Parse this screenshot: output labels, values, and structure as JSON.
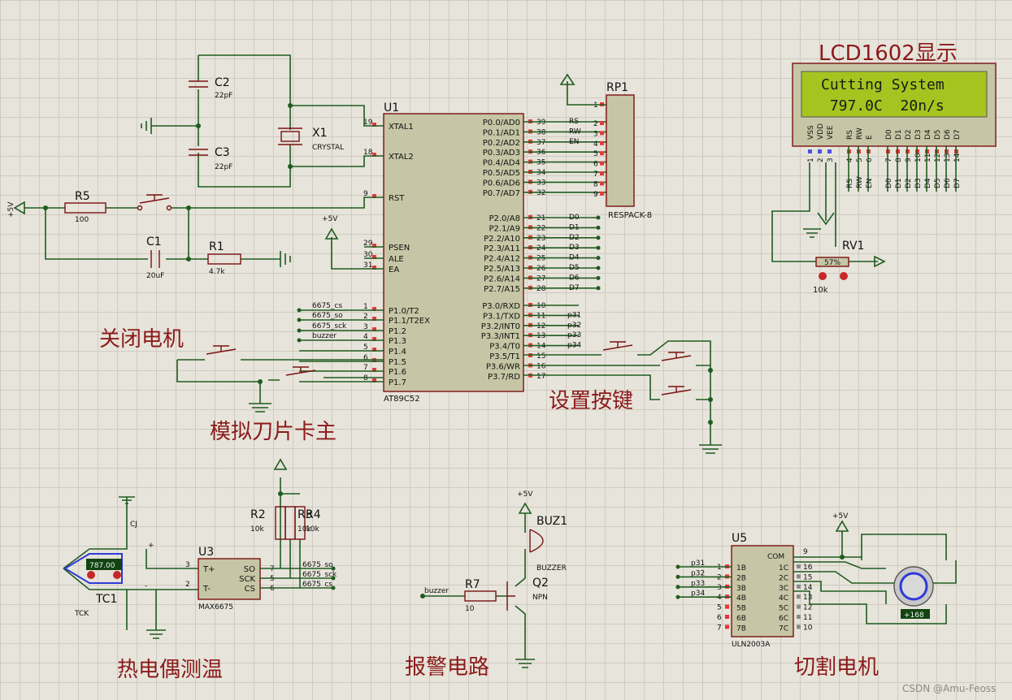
{
  "labels": {
    "lcd_title": "LCD1602显示",
    "close_motor": "关闭电机",
    "simulate_blade": "模拟刀片卡主",
    "set_keys": "设置按键",
    "thermocouple": "热电偶测温",
    "alarm": "报警电路",
    "cut_motor": "切割电机",
    "watermark": "CSDN @Amu-Feoss"
  },
  "lcd": {
    "line1": "Cutting System",
    "line2": " 797.0C  20n/s",
    "pins": [
      "VSS",
      "VDD",
      "VEE",
      "RS",
      "RW",
      "E",
      "D0",
      "D1",
      "D2",
      "D3",
      "D4",
      "D5",
      "D6",
      "D7"
    ],
    "nums": [
      "1",
      "2",
      "3",
      "4",
      "5",
      "6",
      "7",
      "8",
      "9",
      "10",
      "11",
      "12",
      "13",
      "14"
    ],
    "net": [
      "RS",
      "RW",
      "EN",
      "D0",
      "D1",
      "D2",
      "D3",
      "D4",
      "D5",
      "D6",
      "D7"
    ]
  },
  "u1": {
    "ref": "U1",
    "part": "AT89C52",
    "left": [
      {
        "n": "19",
        "name": "XTAL1"
      },
      {
        "n": "18",
        "name": "XTAL2"
      },
      {
        "n": "9",
        "name": "RST"
      },
      {
        "n": "29",
        "name": "PSEN"
      },
      {
        "n": "30",
        "name": "ALE"
      },
      {
        "n": "31",
        "name": "EA"
      },
      {
        "n": "1",
        "name": "P1.0/T2",
        "net": "6675_cs"
      },
      {
        "n": "2",
        "name": "P1.1/T2EX",
        "net": "6675_so"
      },
      {
        "n": "3",
        "name": "P1.2",
        "net": "6675_sck"
      },
      {
        "n": "4",
        "name": "P1.3",
        "net": "buzzer"
      },
      {
        "n": "5",
        "name": "P1.4"
      },
      {
        "n": "6",
        "name": "P1.5"
      },
      {
        "n": "7",
        "name": "P1.6"
      },
      {
        "n": "8",
        "name": "P1.7"
      }
    ],
    "right": [
      {
        "n": "39",
        "name": "P0.0/AD0",
        "net": "RS"
      },
      {
        "n": "38",
        "name": "P0.1/AD1",
        "net": "RW"
      },
      {
        "n": "37",
        "name": "P0.2/AD2",
        "net": "EN"
      },
      {
        "n": "36",
        "name": "P0.3/AD3"
      },
      {
        "n": "35",
        "name": "P0.4/AD4"
      },
      {
        "n": "34",
        "name": "P0.5/AD5"
      },
      {
        "n": "33",
        "name": "P0.6/AD6"
      },
      {
        "n": "32",
        "name": "P0.7/AD7"
      },
      {
        "n": "21",
        "name": "P2.0/A8",
        "net": "D0"
      },
      {
        "n": "22",
        "name": "P2.1/A9",
        "net": "D1"
      },
      {
        "n": "23",
        "name": "P2.2/A10",
        "net": "D2"
      },
      {
        "n": "24",
        "name": "P2.3/A11",
        "net": "D3"
      },
      {
        "n": "25",
        "name": "P2.4/A12",
        "net": "D4"
      },
      {
        "n": "26",
        "name": "P2.5/A13",
        "net": "D5"
      },
      {
        "n": "27",
        "name": "P2.6/A14",
        "net": "D6"
      },
      {
        "n": "28",
        "name": "P2.7/A15",
        "net": "D7"
      },
      {
        "n": "10",
        "name": "P3.0/RXD"
      },
      {
        "n": "11",
        "name": "P3.1/TXD",
        "net": "p31"
      },
      {
        "n": "12",
        "name": "P3.2/INT0",
        "net": "p32"
      },
      {
        "n": "13",
        "name": "P3.3/INT1",
        "net": "p33"
      },
      {
        "n": "14",
        "name": "P3.4/T0",
        "net": "p34"
      },
      {
        "n": "15",
        "name": "P3.5/T1"
      },
      {
        "n": "16",
        "name": "P3.6/WR"
      },
      {
        "n": "17",
        "name": "P3.7/RD"
      }
    ]
  },
  "rp1": {
    "ref": "RP1",
    "part": "RESPACK-8",
    "pins": [
      "1",
      "2",
      "3",
      "4",
      "5",
      "6",
      "7",
      "8",
      "9"
    ]
  },
  "osc": {
    "c2": "C2",
    "c2v": "22pF",
    "c3": "C3",
    "c3v": "22pF",
    "x1": "X1",
    "x1v": "CRYSTAL"
  },
  "reset": {
    "r5": "R5",
    "r5v": "100",
    "c1": "C1",
    "c1v": "20uF",
    "r1": "R1",
    "r1v": "4.7k",
    "vcc": "+5V",
    "ea_vcc": "+5V"
  },
  "rv1": {
    "ref": "RV1",
    "val": "10k",
    "pct": "57%"
  },
  "tc": {
    "ref": "TC1",
    "type": "TCK",
    "temp": "787.00",
    "cj": "CJ",
    "plus": "+",
    "minus": "-"
  },
  "u3": {
    "ref": "U3",
    "part": "MAX6675",
    "pins": [
      {
        "n": "3",
        "name": "T+"
      },
      {
        "n": "2",
        "name": "T-"
      },
      {
        "n": "7",
        "name": "SO",
        "net": "6675_so"
      },
      {
        "n": "5",
        "name": "SCK",
        "net": "6675_sck"
      },
      {
        "n": "6",
        "name": "CS",
        "net": "6675_cs"
      }
    ]
  },
  "pullups": {
    "r2": "R2",
    "r2v": "10k",
    "r3": "R3",
    "r3v": "10k",
    "r4": "R4",
    "r4v": "10k"
  },
  "alarm": {
    "vcc": "+5V",
    "buz": "BUZ1",
    "buzv": "BUZZER",
    "q": "Q2",
    "qv": "NPN",
    "r7": "R7",
    "r7v": "10",
    "net": "buzzer"
  },
  "u5": {
    "ref": "U5",
    "part": "ULN2003A",
    "vcc": "+5V",
    "com": "COM",
    "in": [
      {
        "n": "1",
        "name": "1B",
        "net": "p31"
      },
      {
        "n": "2",
        "name": "2B",
        "net": "p32"
      },
      {
        "n": "3",
        "name": "3B",
        "net": "p33"
      },
      {
        "n": "4",
        "name": "4B",
        "net": "p34"
      },
      {
        "n": "5",
        "name": "5B"
      },
      {
        "n": "6",
        "name": "6B"
      },
      {
        "n": "7",
        "name": "7B"
      }
    ],
    "out": [
      {
        "n": "16",
        "name": "1C"
      },
      {
        "n": "15",
        "name": "2C"
      },
      {
        "n": "14",
        "name": "3C"
      },
      {
        "n": "13",
        "name": "4C"
      },
      {
        "n": "12",
        "name": "5C"
      },
      {
        "n": "11",
        "name": "6C"
      },
      {
        "n": "10",
        "name": "7C"
      }
    ],
    "com_n": "9",
    "motor": "+168"
  }
}
